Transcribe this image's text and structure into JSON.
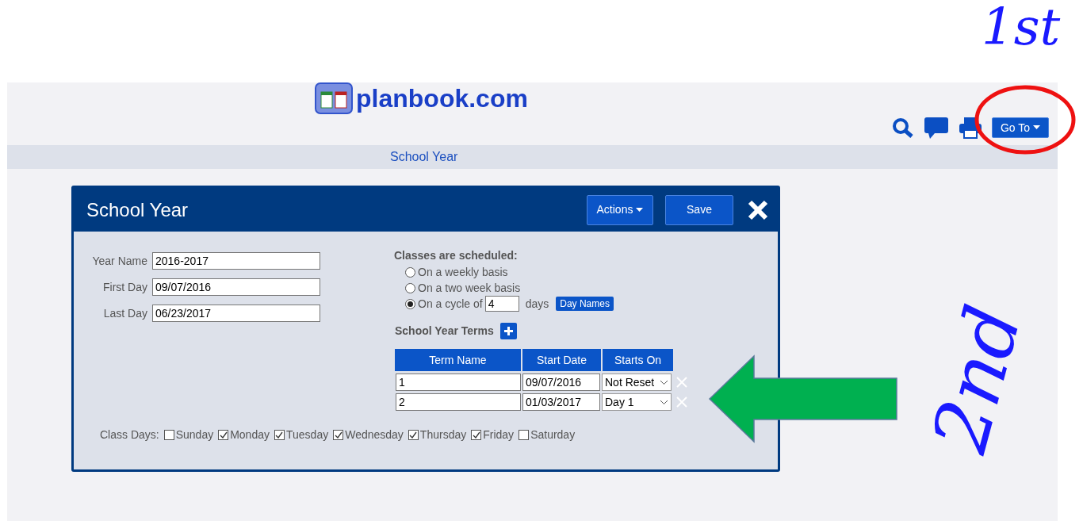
{
  "header": {
    "logo_text": "planbook.com",
    "goto_button": "Go To"
  },
  "nav": {
    "link": "School Year"
  },
  "dialog": {
    "title": "School Year",
    "actions_button": "Actions",
    "save_button": "Save",
    "fields": [
      {
        "label": "Year Name",
        "value": "2016-2017"
      },
      {
        "label": "First Day",
        "value": "09/07/2016"
      },
      {
        "label": "Last Day",
        "value": "06/23/2017"
      }
    ],
    "schedule": {
      "heading": "Classes are scheduled:",
      "options": [
        {
          "label": "On a weekly basis",
          "selected": false,
          "kind": "plain"
        },
        {
          "label": "On a two week basis",
          "selected": false,
          "kind": "plain"
        },
        {
          "label": "On a cycle of",
          "selected": true,
          "kind": "cycle",
          "value": "4",
          "suffix": "days",
          "button": "Day Names"
        }
      ]
    },
    "terms": {
      "heading": "School Year Terms",
      "columns": [
        "Term Name",
        "Start Date",
        "Starts On"
      ],
      "rows": [
        {
          "name": "1",
          "start_date": "09/07/2016",
          "starts_on": "Not Reset"
        },
        {
          "name": "2",
          "start_date": "01/03/2017",
          "starts_on": "Day 1"
        }
      ]
    },
    "class_days": {
      "label": "Class Days:",
      "days": [
        {
          "label": "Sunday",
          "checked": false
        },
        {
          "label": "Monday",
          "checked": true
        },
        {
          "label": "Tuesday",
          "checked": true
        },
        {
          "label": "Wednesday",
          "checked": true
        },
        {
          "label": "Thursday",
          "checked": true
        },
        {
          "label": "Friday",
          "checked": true
        },
        {
          "label": "Saturday",
          "checked": false
        }
      ]
    }
  },
  "annotations": {
    "first": "1st",
    "second": "2nd"
  }
}
